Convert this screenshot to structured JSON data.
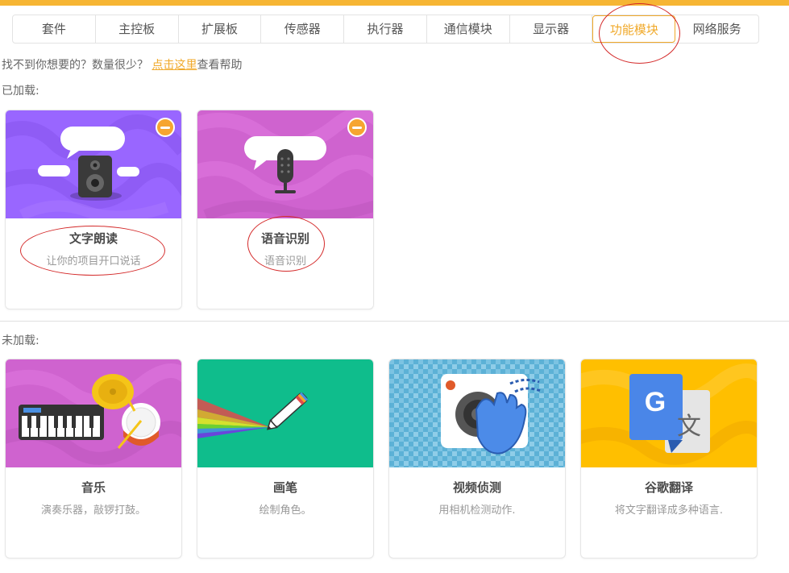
{
  "tabs": [
    {
      "label": "套件"
    },
    {
      "label": "主控板"
    },
    {
      "label": "扩展板"
    },
    {
      "label": "传感器"
    },
    {
      "label": "执行器"
    },
    {
      "label": "通信模块"
    },
    {
      "label": "显示器"
    },
    {
      "label": "功能模块",
      "active": true
    },
    {
      "label": "网络服务"
    }
  ],
  "help": {
    "prefix": "找不到你想要的？数量很少？ ",
    "link": "点击这里",
    "suffix": "查看帮助"
  },
  "loaded": {
    "label": "已加载:",
    "cards": [
      {
        "title": "文字朗读",
        "desc": "让你的项目开口说话",
        "icon": "speaker-icon",
        "bg": "#9966ff"
      },
      {
        "title": "语音识别",
        "desc": "语音识别",
        "icon": "microphone-icon",
        "bg": "#cf63cf"
      }
    ]
  },
  "unloaded": {
    "label": "未加载:",
    "cards": [
      {
        "title": "音乐",
        "desc": "演奏乐器，敲锣打鼓。",
        "icon": "music-icon",
        "bg": "#cf63cf"
      },
      {
        "title": "画笔",
        "desc": "绘制角色。",
        "icon": "pen-icon",
        "bg": "#0fbd8c"
      },
      {
        "title": "视频侦测",
        "desc": "用相机检测动作.",
        "icon": "video-sensing-icon",
        "bg": "#5cb1d6"
      },
      {
        "title": "谷歌翻译",
        "desc": "将文字翻译成多种语言.",
        "icon": "translate-icon",
        "bg": "#ffbf00"
      }
    ]
  },
  "colors": {
    "accent": "#f0a92a",
    "top_bar": "#f6b533",
    "annotation": "#d42a2a"
  }
}
